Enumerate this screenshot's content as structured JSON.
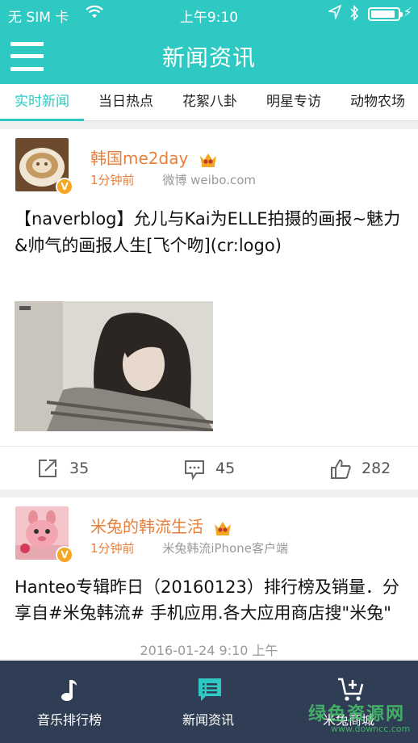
{
  "status_bar": {
    "carrier": "无 SIM 卡",
    "time": "上午9:10",
    "battery_level": 0.9
  },
  "nav": {
    "title": "新闻资讯",
    "menu_icon": "hamburger-menu-icon"
  },
  "tabs": [
    {
      "label": "实时新闻",
      "active": true
    },
    {
      "label": "当日热点",
      "active": false
    },
    {
      "label": "花絮八卦",
      "active": false
    },
    {
      "label": "明星专访",
      "active": false
    },
    {
      "label": "动物农场",
      "active": false
    }
  ],
  "posts": [
    {
      "author": "韩国me2day",
      "time_ago": "1分钟前",
      "source": "微博 weibo.com",
      "verified_badge": "V",
      "content": "【naverblog】允儿与Kai为ELLE拍摄的画报~魅力&帅气的画报人生[飞个吻](cr:logo)",
      "shares": "35",
      "comments": "45",
      "likes": "282"
    },
    {
      "author": "米兔的韩流生活",
      "time_ago": "1分钟前",
      "source": "米兔韩流iPhone客户端",
      "verified_badge": "V",
      "content": "Hanteo专辑昨日（20160123）排行榜及销量．分享自#米兔韩流# 手机应用.各大应用商店搜\"米兔\""
    }
  ],
  "timestamp_overlay": "2016-01-24 9:10 上午",
  "bottom_tabs": [
    {
      "label": "音乐排行榜",
      "icon": "music-note-icon"
    },
    {
      "label": "新闻资讯",
      "icon": "chat-news-icon"
    },
    {
      "label": "米兔商城",
      "icon": "shopping-cart-icon"
    }
  ],
  "watermark": {
    "text": "绿色资源网",
    "url": "www.downcc.com"
  },
  "colors": {
    "accent": "#2ec9c2",
    "author": "#e8803a",
    "bottom_bar": "#2f3e54"
  }
}
